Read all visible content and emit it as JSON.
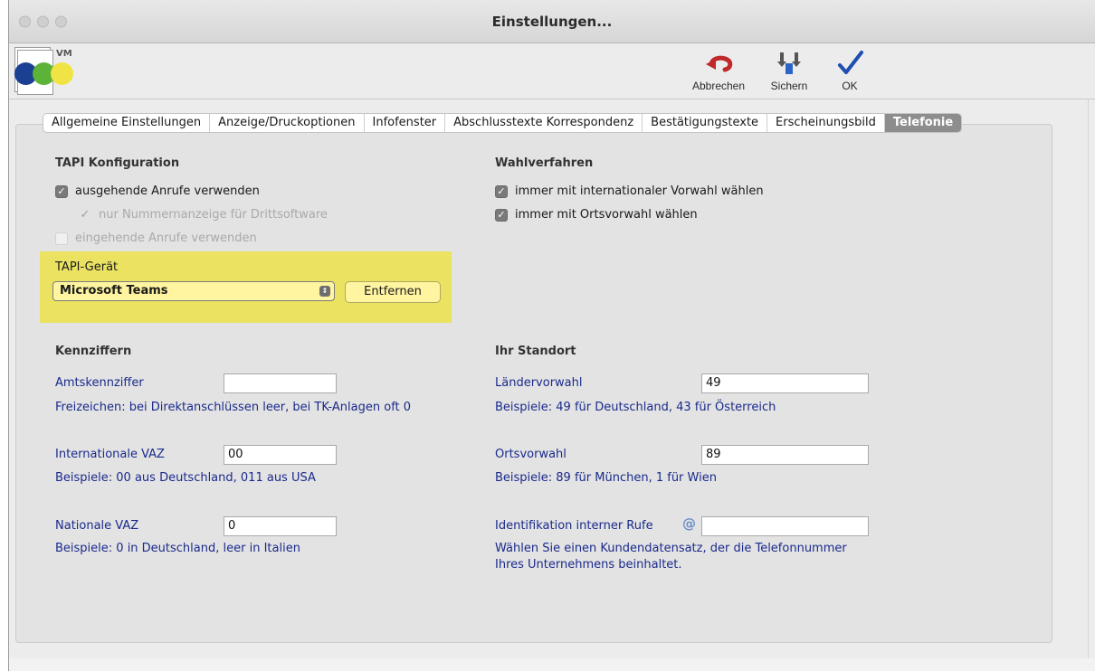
{
  "window": {
    "title": "Einstellungen..."
  },
  "logo": {
    "text": "VM"
  },
  "toolbar": {
    "cancel_label": "Abbrechen",
    "save_label": "Sichern",
    "ok_label": "OK"
  },
  "tabs": [
    {
      "label": "Allgemeine Einstellungen"
    },
    {
      "label": "Anzeige/Druckoptionen"
    },
    {
      "label": "Infofenster"
    },
    {
      "label": "Abschlusstexte Korrespondenz"
    },
    {
      "label": "Bestätigungstexte"
    },
    {
      "label": "Erscheinungsbild"
    },
    {
      "label": "Telefonie"
    }
  ],
  "active_tab": "Telefonie",
  "tapi": {
    "heading": "TAPI Konfiguration",
    "outgoing": {
      "label": "ausgehende Anrufe verwenden",
      "checked": true
    },
    "number_display": {
      "label": "nur Nummernanzeige für Drittsoftware",
      "checked": true,
      "disabled": true
    },
    "incoming": {
      "label": "eingehende Anrufe verwenden",
      "checked": false,
      "disabled": true
    },
    "device_label": "TAPI-Gerät",
    "device_value": "Microsoft Teams",
    "remove_label": "Entfernen"
  },
  "dialing": {
    "heading": "Wahlverfahren",
    "international": {
      "label": "immer mit internationaler Vorwahl wählen",
      "checked": true
    },
    "local": {
      "label": "immer mit Ortsvorwahl wählen",
      "checked": true
    }
  },
  "codes": {
    "heading": "Kennziffern",
    "trunk": {
      "label": "Amtskennziffer",
      "value": "",
      "hint": "Freizeichen: bei Direktanschlüssen leer, bei TK-Anlagen oft 0"
    },
    "intl": {
      "label": "Internationale VAZ",
      "value": "00",
      "hint": "Beispiele: 00 aus Deutschland, 011 aus USA"
    },
    "national": {
      "label": "Nationale VAZ",
      "value": "0",
      "hint": "Beispiele: 0 in Deutschland, leer in Italien"
    }
  },
  "location": {
    "heading": "Ihr Standort",
    "country": {
      "label": "Ländervorwahl",
      "value": "49",
      "hint": "Beispiele: 49 für Deutschland, 43 für Österreich"
    },
    "area": {
      "label": "Ortsvorwahl",
      "value": "89",
      "hint": "Beispiele: 89 für München, 1 für Wien"
    },
    "internal": {
      "label": "Identifikation interner Rufe",
      "at_symbol": "@",
      "value": "",
      "hint_line1": "Wählen Sie einen Kundendatensatz, der die Telefonnummer",
      "hint_line2": "Ihres Unternehmens beinhaltet."
    }
  },
  "colors": {
    "highlight": "#ebe262",
    "label_blue": "#1a2a8c",
    "active_tab": "#8d8d8d"
  }
}
